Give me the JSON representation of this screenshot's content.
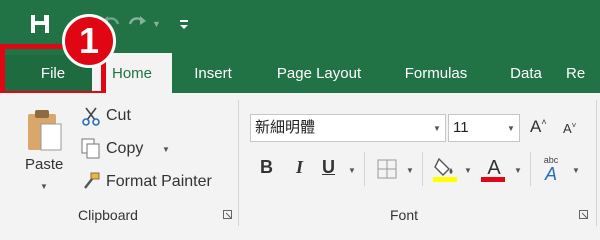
{
  "qat": {
    "save_icon": "save-icon",
    "undo_icon": "undo-icon",
    "redo_icon": "redo-icon",
    "customize_icon": "customize-qat-icon"
  },
  "badge": {
    "number": "1"
  },
  "tabs": [
    {
      "label": "File"
    },
    {
      "label": "Home"
    },
    {
      "label": "Insert"
    },
    {
      "label": "Page Layout"
    },
    {
      "label": "Formulas"
    },
    {
      "label": "Data"
    },
    {
      "label": "Re"
    }
  ],
  "clipboard": {
    "paste_label": "Paste",
    "cut_label": "Cut",
    "copy_label": "Copy",
    "format_painter_label": "Format Painter",
    "group_label": "Clipboard"
  },
  "font": {
    "font_name": "新細明體",
    "font_size": "11",
    "grow_label": "A",
    "shrink_label": "A",
    "bold_label": "B",
    "italic_label": "I",
    "underline_label": "U",
    "font_color_label": "A",
    "phonetic_label": "abc",
    "phonetic_letter": "A",
    "group_label": "Font"
  },
  "colors": {
    "green": "#217346",
    "red_highlight": "#e10613",
    "fill_yellow": "#ffff00",
    "font_red": "#e10613"
  }
}
